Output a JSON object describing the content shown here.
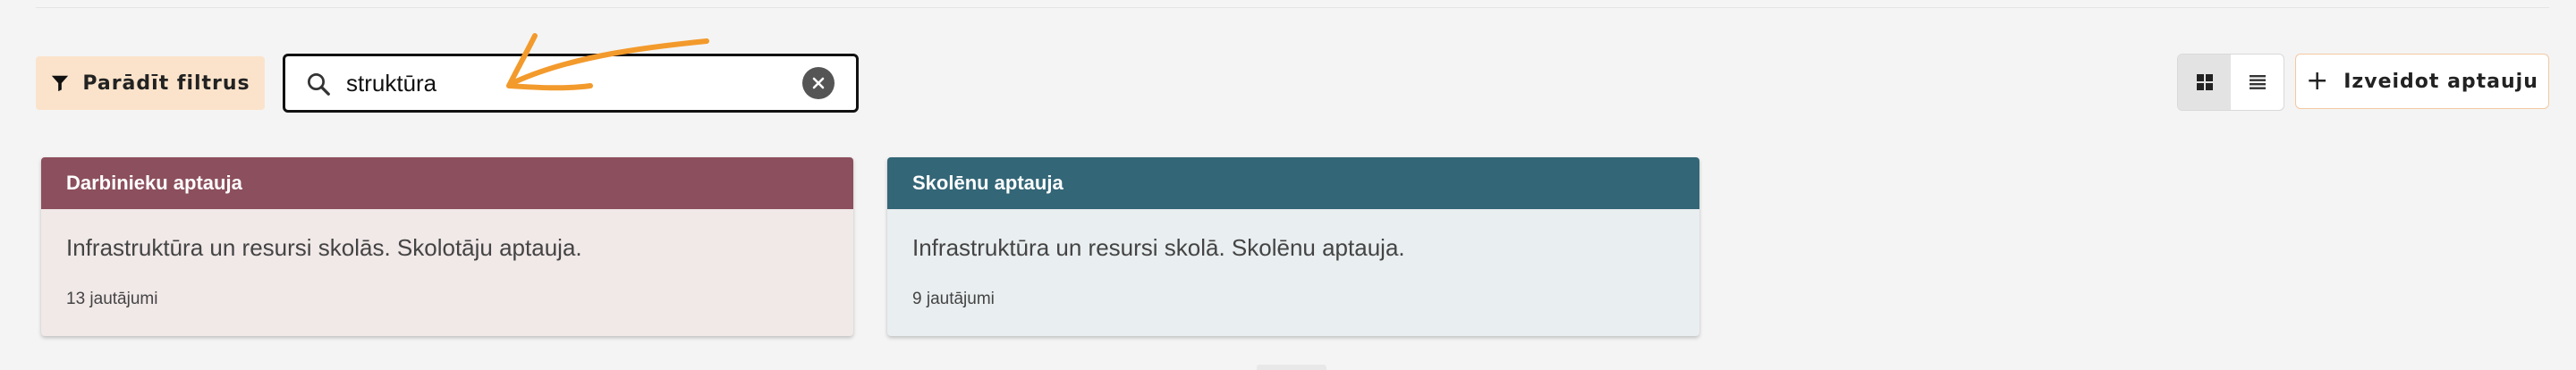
{
  "toolbar": {
    "filter_button_label": "Parādīt filtrus",
    "search_value": "struktūra",
    "create_button_label": "Izveidot aptauju",
    "view_mode": "grid"
  },
  "icons": {
    "filter": "filter-icon",
    "search": "search-icon",
    "clear": "clear-icon",
    "grid": "grid-view-icon",
    "list": "list-view-icon",
    "plus": "plus-icon"
  },
  "colors": {
    "filter_button_bg": "#fbe3cb",
    "annotation_arrow": "#f39a2c",
    "card1_header": "#8c4f5d",
    "card1_body": "#f1e8e8",
    "card2_header": "#336677",
    "card2_body": "#e9eef0"
  },
  "cards": [
    {
      "title": "Darbinieku aptauja",
      "description": "Infrastruktūra un resursi skolās. Skolotāju aptauja.",
      "question_count": "13 jautājumi"
    },
    {
      "title": "Skolēnu aptauja",
      "description": "Infrastruktūra un resursi skolā. Skolēnu aptauja.",
      "question_count": "9 jautājumi"
    }
  ]
}
